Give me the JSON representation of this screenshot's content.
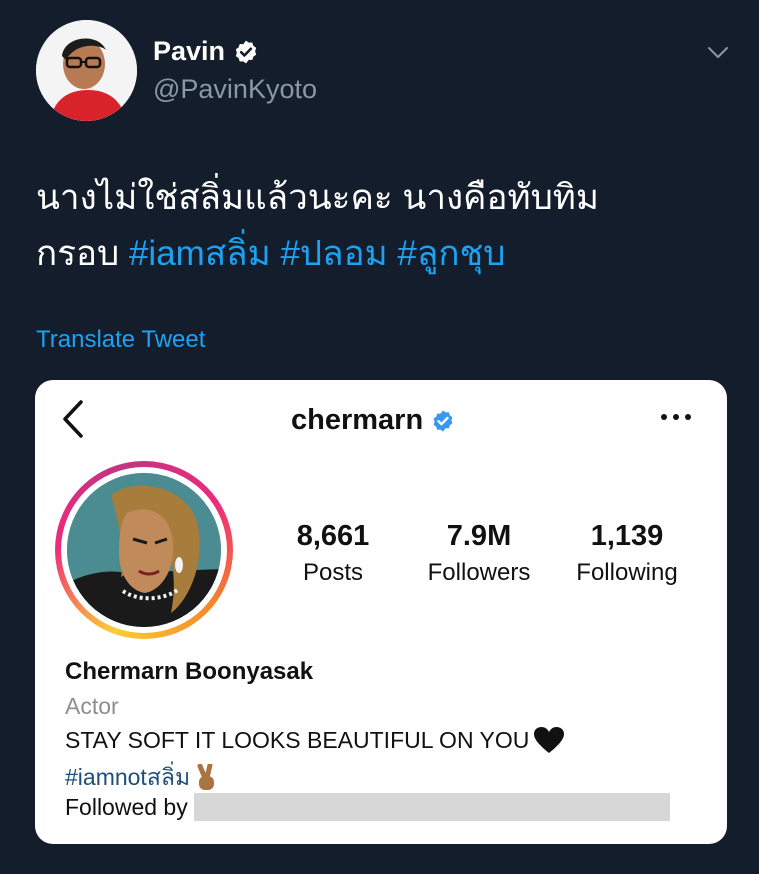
{
  "tweet": {
    "author_name": "Pavin",
    "author_handle": "@PavinKyoto",
    "text_line1": "นางไม่ใช่สลิ่มแล้วนะคะ นางคือทับทิม",
    "text_line2_prefix": "กรอบ ",
    "hashtags": [
      "#iamสลิ่ม",
      "#ปลอม",
      "#ลูกชุบ"
    ],
    "translate_label": "Translate Tweet"
  },
  "instagram": {
    "username": "chermarn",
    "stats": [
      {
        "value": "8,661",
        "label": "Posts"
      },
      {
        "value": "7.9M",
        "label": "Followers"
      },
      {
        "value": "1,139",
        "label": "Following"
      }
    ],
    "full_name": "Chermarn Boonyasak",
    "category": "Actor",
    "bio_line": "STAY SOFT IT LOOKS BEAUTIFUL ON YOU",
    "bio_hashtag": "#iamnotสลิ่ม",
    "followed_by_label": "Followed by"
  },
  "colors": {
    "background": "#141d2b",
    "link_blue": "#1da1f2",
    "ig_tag": "#1e4e79",
    "verified": "#3897f0"
  },
  "icons": {
    "verified": "verified-badge-icon",
    "chevron": "chevron-down-icon",
    "back": "back-arrow-icon",
    "more": "more-dots-icon",
    "heart": "black-heart-icon",
    "peace": "victory-hand-icon"
  }
}
